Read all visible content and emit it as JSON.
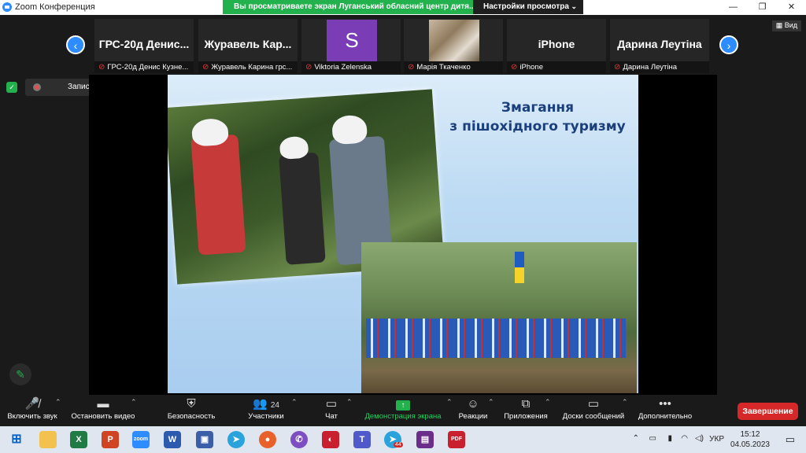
{
  "window": {
    "title": "Zoom Конференция",
    "controls": [
      "—",
      "❐",
      "✕"
    ]
  },
  "banner": {
    "text": "Вы просматриваете экран Луганський обласний центр дитя...",
    "view_settings": "Настройки просмотра"
  },
  "participants": [
    {
      "big_name": "ГРС-20д Денис...",
      "label": "ГРС-20д Денис Кузне..."
    },
    {
      "big_name": "Журавель Кар...",
      "label": "Журавель Карина грс..."
    },
    {
      "avatar_letter": "S",
      "label": "Viktoria Zelenska"
    },
    {
      "label": "Марія Ткаченко"
    },
    {
      "big_name": "iPhone",
      "label": "iPhone"
    },
    {
      "big_name": "Дарина Леутіна",
      "label": "Дарина Леутіна"
    }
  ],
  "view_button": "Вид",
  "recording": {
    "label": "Запись..."
  },
  "slide": {
    "title_line1": "Змагання",
    "title_line2": "з пішохідного туризму"
  },
  "toolbar": {
    "mute": "Включить звук",
    "video": "Остановить видео",
    "security": "Безопасность",
    "participants": "Участники",
    "participants_count": "24",
    "chat": "Чат",
    "share": "Демонстрация экрана",
    "reactions": "Реакции",
    "apps": "Приложения",
    "whiteboards": "Доски сообщений",
    "more": "Дополнительно",
    "end": "Завершение"
  },
  "taskbar": {
    "lang": "УКР",
    "time": "15:12",
    "date": "04.05.2023",
    "badge": "44",
    "icons": [
      "windows-icon",
      "file-explorer-icon",
      "excel-icon",
      "powerpoint-icon",
      "zoom-icon",
      "word-icon",
      "save-icon",
      "telegram-icon",
      "firefox-icon",
      "viber-icon",
      "app-icon",
      "teams-icon",
      "telegram-active-icon",
      "winrar-icon",
      "pdf-icon"
    ]
  },
  "colors": {
    "accent": "#2D8CFF",
    "green": "#23b14d",
    "end": "#d62828"
  }
}
